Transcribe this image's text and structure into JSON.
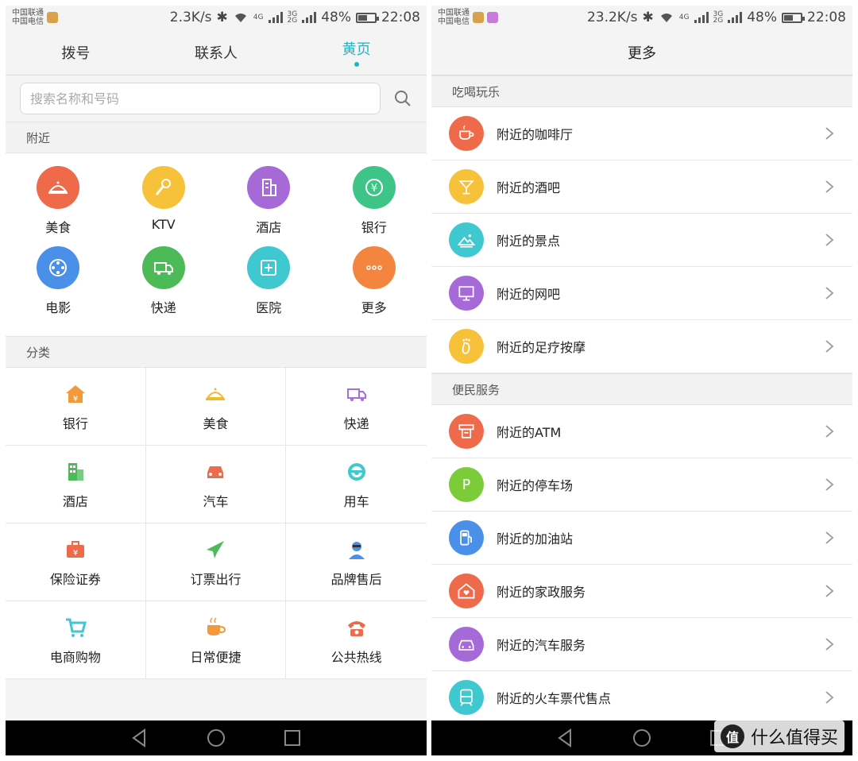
{
  "status_left": {
    "carrier1": "中国联通",
    "carrier2": "中国电信",
    "speed": "2.3K/s",
    "net1": "4G",
    "net2": "3G",
    "net3": "2G",
    "battery": "48%",
    "time": "22:08"
  },
  "status_right": {
    "carrier1": "中国联通",
    "carrier2": "中国电信",
    "speed": "23.2K/s",
    "net1": "4G",
    "net2": "3G",
    "net3": "2G",
    "battery": "48%",
    "time": "22:08"
  },
  "tabs": [
    {
      "label": "拨号"
    },
    {
      "label": "联系人"
    },
    {
      "label": "黄页"
    }
  ],
  "search": {
    "placeholder": "搜索名称和号码"
  },
  "nearby": {
    "title": "附近",
    "items": [
      {
        "label": "美食",
        "color": "#ee6a4a",
        "icon": "dish-icon"
      },
      {
        "label": "KTV",
        "color": "#f8c13a",
        "icon": "microphone-icon"
      },
      {
        "label": "酒店",
        "color": "#a569d8",
        "icon": "hotel-icon"
      },
      {
        "label": "银行",
        "color": "#3fc487",
        "icon": "yuan-icon"
      },
      {
        "label": "电影",
        "color": "#4b90e8",
        "icon": "film-reel-icon"
      },
      {
        "label": "快递",
        "color": "#4cba57",
        "icon": "truck-icon"
      },
      {
        "label": "医院",
        "color": "#3fc8d0",
        "icon": "hospital-icon"
      },
      {
        "label": "更多",
        "color": "#f4853e",
        "icon": "more-dots-icon"
      }
    ]
  },
  "category": {
    "title": "分类",
    "items": [
      {
        "label": "银行",
        "color": "#f29a3a",
        "icon": "bank-icon"
      },
      {
        "label": "美食",
        "color": "#f5b731",
        "icon": "dish-icon"
      },
      {
        "label": "快递",
        "color": "#a66ddb",
        "icon": "truck-icon"
      },
      {
        "label": "酒店",
        "color": "#4cba57",
        "icon": "building-icon"
      },
      {
        "label": "汽车",
        "color": "#ee6a4a",
        "icon": "car-icon"
      },
      {
        "label": "用车",
        "color": "#3fc8d0",
        "icon": "steering-wheel-icon"
      },
      {
        "label": "保险证券",
        "color": "#ee6a4a",
        "icon": "briefcase-icon"
      },
      {
        "label": "订票出行",
        "color": "#4cba57",
        "icon": "airplane-icon"
      },
      {
        "label": "品牌售后",
        "color": "#4b90e8",
        "icon": "agent-icon"
      },
      {
        "label": "电商购物",
        "color": "#3fc8d0",
        "icon": "cart-icon"
      },
      {
        "label": "日常便捷",
        "color": "#f29a3a",
        "icon": "coffee-icon"
      },
      {
        "label": "公共热线",
        "color": "#ee6a4a",
        "icon": "phone-icon"
      }
    ]
  },
  "more": {
    "title": "更多",
    "sections": [
      {
        "title": "吃喝玩乐",
        "items": [
          {
            "label": "附近的咖啡厅",
            "color": "#ee6a4a",
            "icon": "coffee-cup-icon"
          },
          {
            "label": "附近的酒吧",
            "color": "#f8c13a",
            "icon": "cocktail-icon"
          },
          {
            "label": "附近的景点",
            "color": "#3fc8d0",
            "icon": "scenery-icon"
          },
          {
            "label": "附近的网吧",
            "color": "#a569d8",
            "icon": "monitor-icon"
          },
          {
            "label": "附近的足疗按摩",
            "color": "#f8c13a",
            "icon": "foot-icon"
          }
        ]
      },
      {
        "title": "便民服务",
        "items": [
          {
            "label": "附近的ATM",
            "color": "#ee6a4a",
            "icon": "atm-icon"
          },
          {
            "label": "附近的停车场",
            "color": "#7ccc3a",
            "icon": "parking-icon"
          },
          {
            "label": "附近的加油站",
            "color": "#4b90e8",
            "icon": "gas-station-icon"
          },
          {
            "label": "附近的家政服务",
            "color": "#ee6a4a",
            "icon": "home-heart-icon"
          },
          {
            "label": "附近的汽车服务",
            "color": "#a569d8",
            "icon": "car-service-icon"
          },
          {
            "label": "附近的火车票代售点",
            "color": "#3fc8d0",
            "icon": "train-icon"
          }
        ]
      }
    ]
  },
  "watermark": {
    "text": "什么值得买",
    "logo": "值"
  }
}
